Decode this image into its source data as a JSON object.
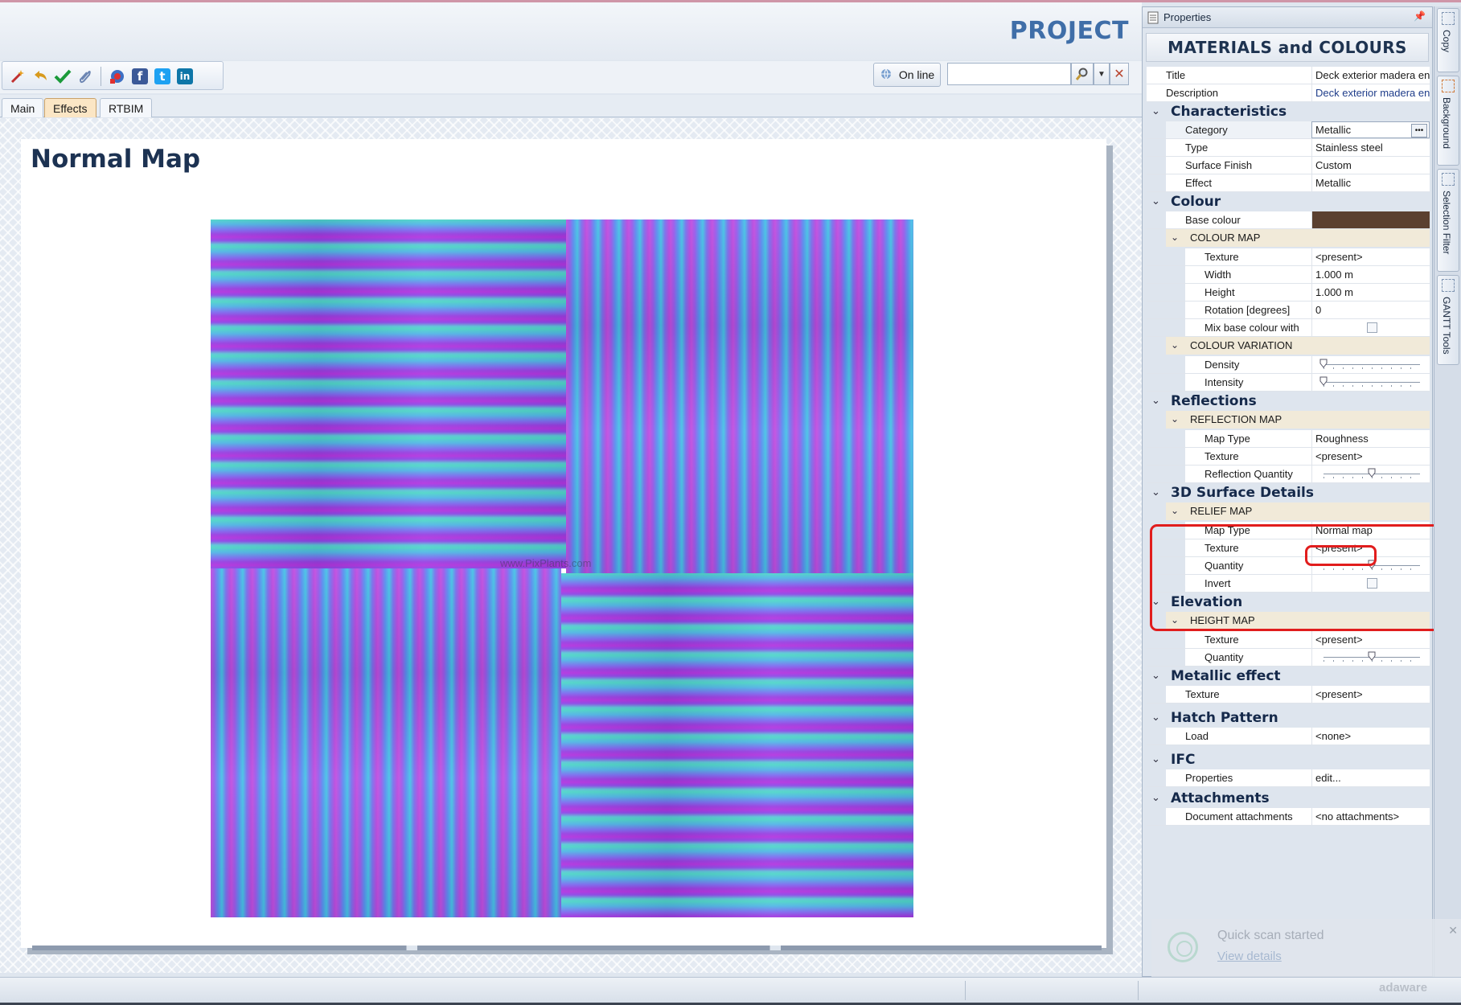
{
  "header": {
    "title": "PROJECT"
  },
  "toolbar": {
    "online_label": "On line",
    "search": {
      "value": "",
      "placeholder": ""
    },
    "icons": [
      "magic-wand-icon",
      "undo-icon",
      "check-icon",
      "paperclip-icon",
      "network-icon",
      "facebook-icon",
      "twitter-icon",
      "linkedin-icon"
    ],
    "social_letters": {
      "facebook": "f",
      "twitter": "t",
      "linkedin": "in"
    }
  },
  "tabs": [
    {
      "label": "Main"
    },
    {
      "label": "Effects"
    },
    {
      "label": "RTBIM"
    }
  ],
  "main": {
    "page_title": "Normal Map",
    "watermark": "www.PixPlants.com"
  },
  "properties": {
    "panel_title": "Properties",
    "banner": "MATERIALS and COLOURS",
    "rows": {
      "title": {
        "label": "Title",
        "value": "Deck exterior madera en"
      },
      "description": {
        "label": "Description",
        "value": "Deck exterior madera en"
      }
    },
    "characteristics": {
      "label": "Characteristics",
      "category": {
        "label": "Category",
        "value": "Metallic"
      },
      "type": {
        "label": "Type",
        "value": "Stainless steel"
      },
      "surface_finish": {
        "label": "Surface Finish",
        "value": "Custom"
      },
      "effect": {
        "label": "Effect",
        "value": "Metallic"
      }
    },
    "colour": {
      "label": "Colour",
      "base_colour": {
        "label": "Base colour",
        "color": "#5b4030"
      },
      "colour_map": {
        "label": "COLOUR MAP",
        "texture": {
          "label": "Texture",
          "value": "<present>"
        },
        "width": {
          "label": "Width",
          "value": "1.000 m"
        },
        "height": {
          "label": "Height",
          "value": "1.000 m"
        },
        "rotation": {
          "label": "Rotation  [degrees]",
          "value": "0"
        },
        "mix": {
          "label": "Mix base colour with"
        }
      },
      "colour_variation": {
        "label": "COLOUR VARIATION",
        "density": {
          "label": "Density",
          "level": 0
        },
        "intensity": {
          "label": "Intensity",
          "level": 0
        }
      }
    },
    "reflections": {
      "label": "Reflections",
      "reflection_map": {
        "label": "REFLECTION MAP",
        "map_type": {
          "label": "Map Type",
          "value": "Roughness"
        },
        "texture": {
          "label": "Texture",
          "value": "<present>"
        },
        "quantity": {
          "label": "Reflection Quantity",
          "level": 0.5
        }
      }
    },
    "surface_details": {
      "label": "3D Surface Details",
      "relief_map": {
        "label": "RELIEF MAP",
        "map_type": {
          "label": "Map Type",
          "value": "Normal map"
        },
        "texture": {
          "label": "Texture",
          "value": "<present>"
        },
        "quantity": {
          "label": "Quantity",
          "level": 0.5
        },
        "invert": {
          "label": "Invert"
        }
      }
    },
    "elevation": {
      "label": "Elevation",
      "height_map": {
        "label": "HEIGHT MAP",
        "texture": {
          "label": "Texture",
          "value": "<present>"
        },
        "quantity": {
          "label": "Quantity",
          "level": 0.5
        }
      }
    },
    "metallic": {
      "label": "Metallic effect",
      "texture": {
        "label": "Texture",
        "value": "<present>"
      }
    },
    "hatch": {
      "label": "Hatch Pattern",
      "load": {
        "label": "Load",
        "value": "<none>"
      }
    },
    "ifc": {
      "label": "IFC",
      "properties": {
        "label": "Properties",
        "value": "edit..."
      }
    },
    "attachments": {
      "label": "Attachments",
      "documents": {
        "label": "Document attachments",
        "value": "<no attachments>"
      }
    }
  },
  "side_tabs": [
    {
      "label": "Copy"
    },
    {
      "label": "Background"
    },
    {
      "label": "Selection Filter"
    },
    {
      "label": "GANTT Tools"
    }
  ],
  "toast": {
    "title": "Quick scan started",
    "link": "View details",
    "brand": "adaware"
  },
  "colors": {
    "accent": "#3f6ea8",
    "highlight": "#e11d1d",
    "category_band": "#f1ead9"
  }
}
